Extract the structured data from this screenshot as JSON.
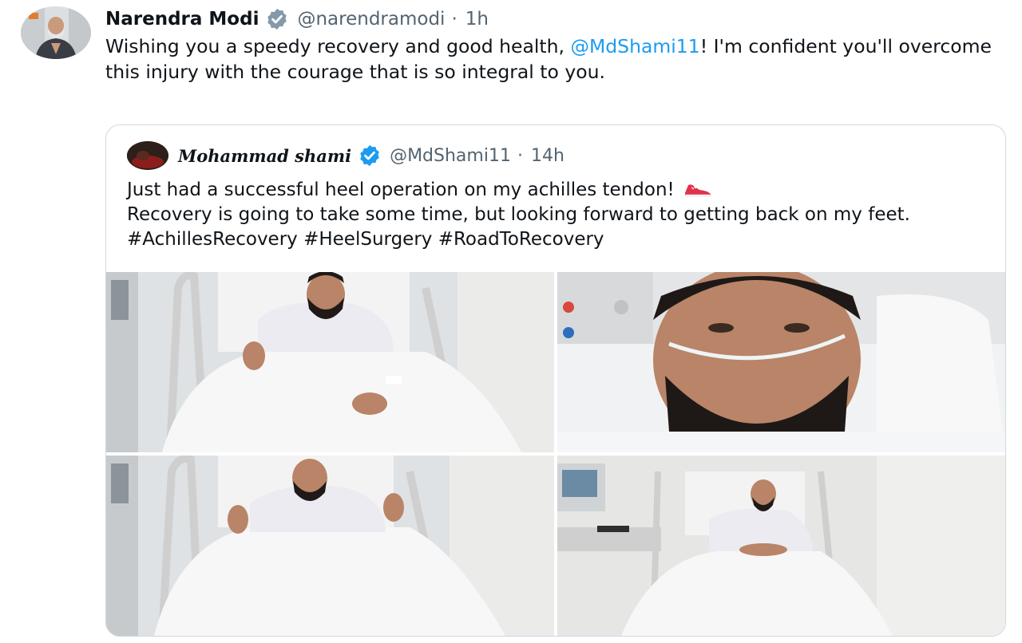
{
  "tweet": {
    "author_name": "Narendra Modi",
    "handle": "@narendramodi",
    "separator": "·",
    "time": "1h",
    "text_before": "Wishing you a speedy recovery and good health, ",
    "mention": "@MdShami11",
    "text_after": "! I'm confident you'll overcome this injury with the courage that is so integral to you."
  },
  "quoted_tweet": {
    "author_name": "Mohammad shami",
    "handle": "@MdShami11",
    "separator": "·",
    "time": "14h",
    "text_line1": "Just had a successful heel operation on my achilles tendon!",
    "text_rest": "Recovery is going to take some time, but looking forward to getting back on my feet. #AchillesRecovery #HeelSurgery #RoadToRecovery",
    "emoji_icon": "running-shoe-icon",
    "photos": [
      {
        "name": "photo-thumbs-up-bed",
        "icon": "hospital-bed-photo"
      },
      {
        "name": "photo-selfie-oxygen-tube",
        "icon": "selfie-photo"
      },
      {
        "name": "photo-double-thumbs-up",
        "icon": "hospital-bed-photo"
      },
      {
        "name": "photo-wide-hospital-room",
        "icon": "hospital-room-photo"
      }
    ]
  },
  "colors": {
    "verified_blue": "#1d9bf0",
    "mention_blue": "#1d9bf0",
    "text_gray": "#536471",
    "card_border": "#cfd9de"
  }
}
